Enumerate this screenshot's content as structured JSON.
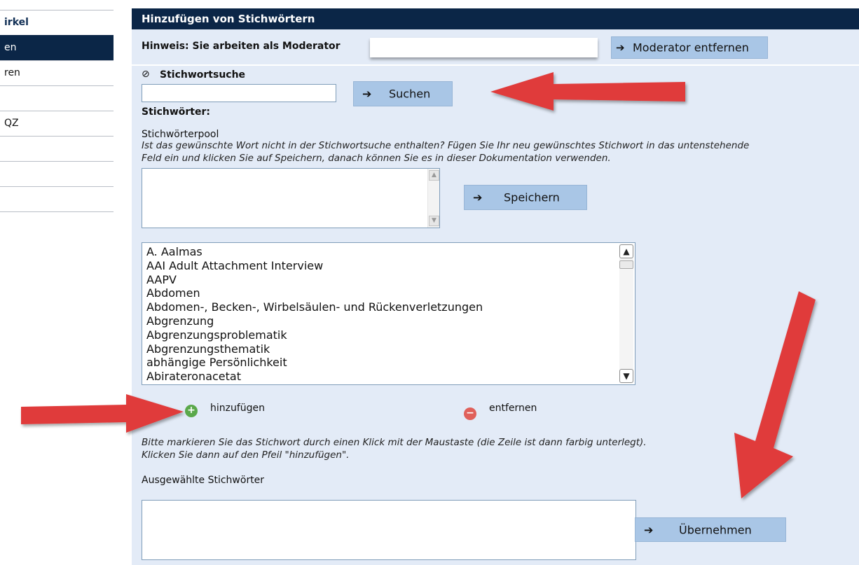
{
  "sidebar": {
    "items": [
      {
        "label": "irkel",
        "style": "head"
      },
      {
        "label": "en",
        "style": "active"
      },
      {
        "label": "ren",
        "style": ""
      },
      {
        "label": "",
        "style": ""
      },
      {
        "label": "QZ",
        "style": ""
      },
      {
        "label": "",
        "style": "muted"
      },
      {
        "label": "",
        "style": ""
      },
      {
        "label": "",
        "style": ""
      }
    ]
  },
  "panel": {
    "title": "Hinzufügen von Stichwörtern",
    "hint": "Hinweis: Sie arbeiten als Moderator",
    "remove_moderator_label": "Moderator entfernen"
  },
  "search": {
    "heading": "Stichwortsuche",
    "value": "",
    "button_label": "Suchen"
  },
  "keywords": {
    "heading": "Stichwörter:",
    "pool_label": "Stichwörterpool",
    "pool_hint_line1": "Ist das gewünschte Wort nicht in der Stichwortsuche enthalten? Fügen Sie Ihr neu gewünschtes Stichwort in das untenstehende",
    "pool_hint_line2": "Feld ein und klicken Sie auf Speichern, danach können Sie es in dieser Dokumentation verwenden.",
    "save_label": "Speichern",
    "list": [
      "A. Aalmas",
      "AAI Adult Attachment Interview",
      "AAPV",
      "Abdomen",
      "Abdomen-, Becken-, Wirbelsäulen- und Rückenverletzungen",
      "Abgrenzung",
      "Abgrenzungsproblematik",
      "Abgrenzungsthematik",
      "abhängige Persönlichkeit",
      "Abirateronacetat"
    ],
    "add_label": "hinzufügen",
    "remove_label": "entfernen",
    "instruction_line1": "Bitte markieren Sie das Stichwort durch einen Klick mit der Maustaste (die Zeile ist dann farbig unterlegt).",
    "instruction_line2": "Klicken Sie dann auf den Pfeil \"hinzufügen\".",
    "selected_label": "Ausgewählte Stichwörter",
    "apply_label": "Übernehmen"
  },
  "icons": {
    "button_arrow": "arrow-right-icon",
    "help": "help-circle-icon",
    "add": "plus-circle-icon",
    "remove": "minus-circle-icon"
  },
  "colors": {
    "header_bg": "#0b2647",
    "panel_bg": "#e3ebf7",
    "button_bg": "#a9c6e6",
    "annotation_arrow": "#e03a3a",
    "add_icon": "#5aa84a",
    "remove_icon": "#e0605a"
  }
}
